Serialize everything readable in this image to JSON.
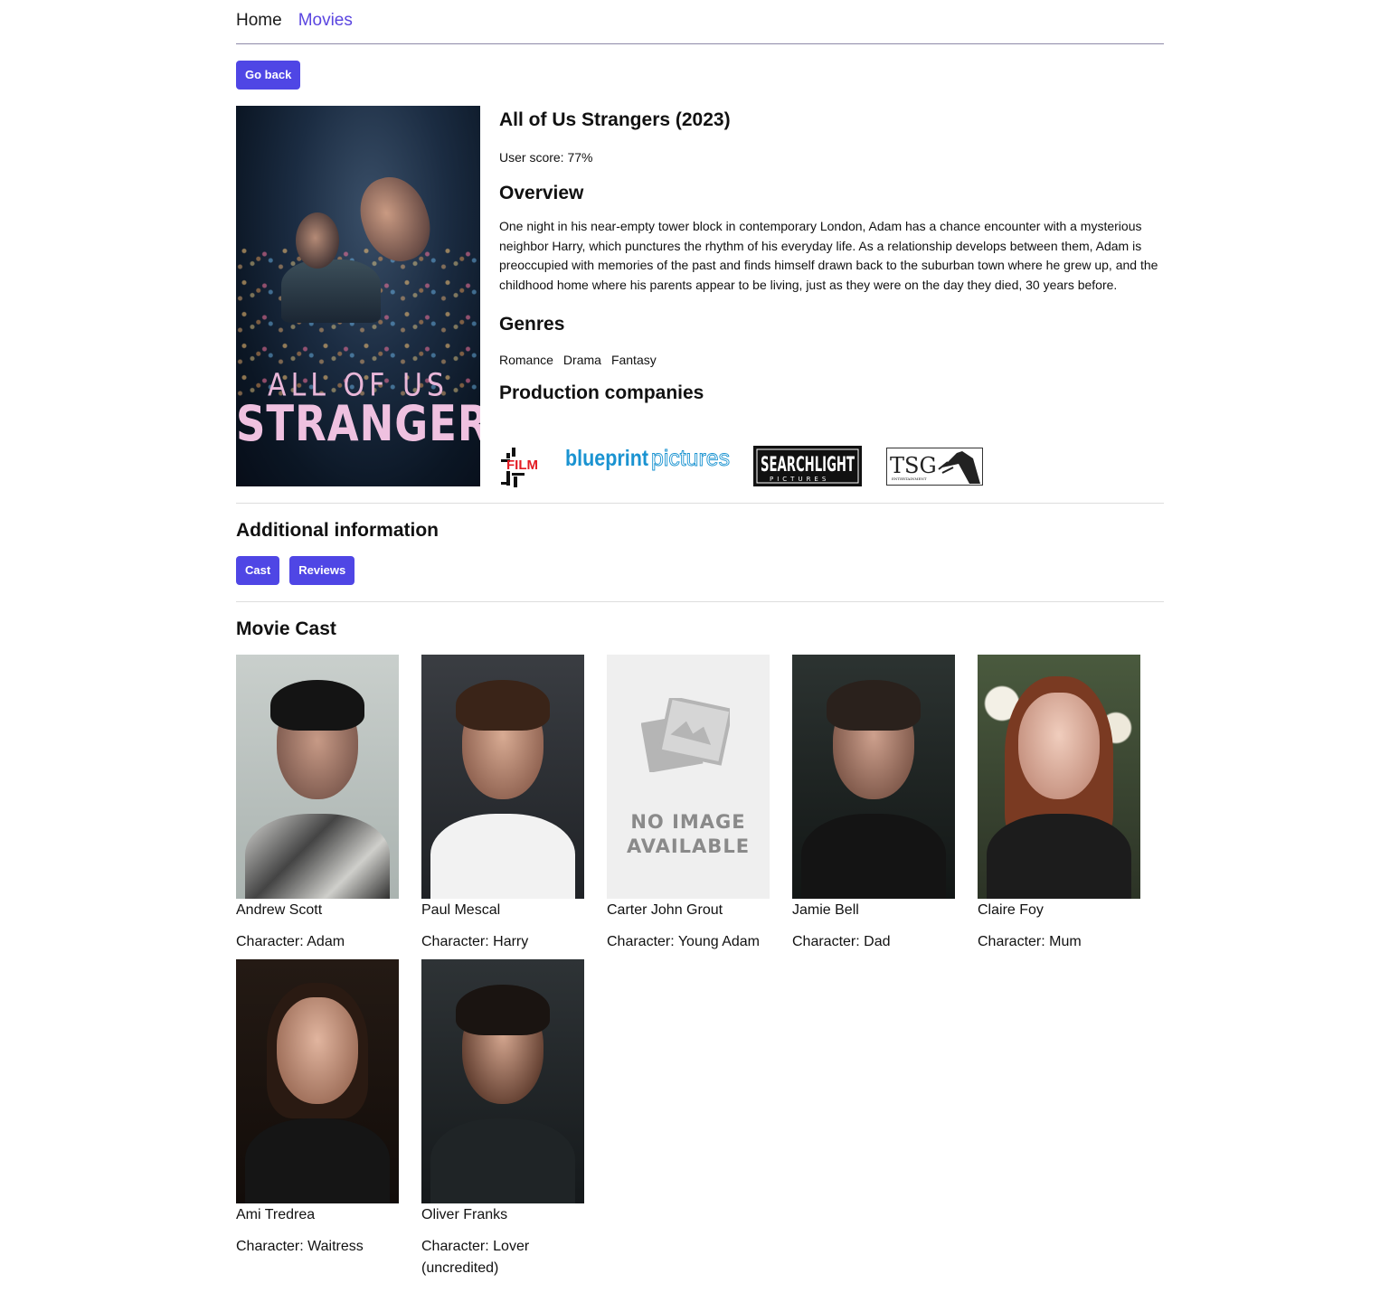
{
  "nav": {
    "home": "Home",
    "movies": "Movies"
  },
  "go_back": "Go back",
  "movie": {
    "title": "All of Us Strangers (2023)",
    "user_score": "User score: 77%",
    "overview_heading": "Overview",
    "overview": "One night in his near-empty tower block in contemporary London, Adam has a chance encounter with a mysterious neighbor Harry, which punctures the rhythm of his everyday life. As a relationship develops between them, Adam is preoccupied with memories of the past and finds himself drawn back to the suburban town where he grew up, and the childhood home where his parents appear to be living, just as they were on the day they died, 30 years before.",
    "genres_heading": "Genres",
    "genres": [
      "Romance",
      "Drama",
      "Fantasy"
    ],
    "companies_heading": "Production companies",
    "poster_text": {
      "line1": "ALL OF US",
      "line2": "STRANGERS"
    },
    "company_logos": {
      "film4": {
        "text": "FILM",
        "numeral": "4",
        "color": "#e31b23"
      },
      "blueprint": {
        "word1": "blueprint",
        "word2": "pictures",
        "color": "#1a93d1"
      },
      "searchlight": {
        "word1": "SEARCHLIGHT",
        "word2": "PICTURES"
      },
      "tsg": {
        "word1": "TSG",
        "word2": "ENTERTAINMENT"
      }
    }
  },
  "additional": {
    "heading": "Additional information",
    "cast_tab": "Cast",
    "reviews_tab": "Reviews"
  },
  "cast_heading": "Movie Cast",
  "no_image": {
    "line1": "NO IMAGE",
    "line2": "AVAILABLE"
  },
  "cast": [
    {
      "name": "Andrew Scott",
      "character": "Character: Adam"
    },
    {
      "name": "Paul Mescal",
      "character": "Character: Harry"
    },
    {
      "name": "Carter John Grout",
      "character": "Character: Young Adam"
    },
    {
      "name": "Jamie Bell",
      "character": "Character: Dad"
    },
    {
      "name": "Claire Foy",
      "character": "Character: Mum"
    },
    {
      "name": "Ami Tredrea",
      "character": "Character: Waitress"
    },
    {
      "name": "Oliver Franks",
      "character": "Character: Lover (uncredited)"
    }
  ],
  "colors": {
    "accent": "#4f46e5",
    "nav_active": "#5a45e0",
    "divider": "#dddddd"
  }
}
